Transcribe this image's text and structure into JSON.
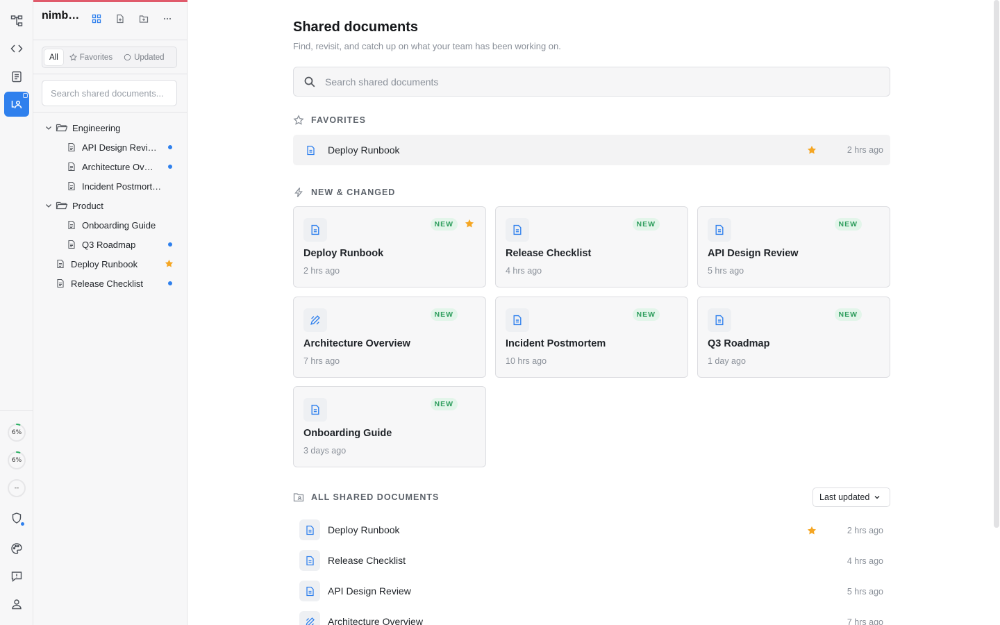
{
  "colors": {
    "accent": "#2f80ed",
    "star": "#f5a623",
    "new_badge_text": "#2e9d5d",
    "new_badge_bg": "#e3f5ea",
    "top_accent": "#e05a6b"
  },
  "rail": {
    "items": [
      {
        "icon": "diagram-icon"
      },
      {
        "icon": "code-icon"
      },
      {
        "icon": "clipboard-icon"
      },
      {
        "icon": "shared-docs-icon",
        "active": true
      }
    ],
    "meters": [
      {
        "label": "6%",
        "value": 0.06
      },
      {
        "label": "6%",
        "value": 0.06
      },
      {
        "label": "--",
        "value": 0
      }
    ],
    "bottom": [
      {
        "icon": "shield-icon"
      },
      {
        "icon": "palette-icon"
      },
      {
        "icon": "feedback-icon"
      },
      {
        "icon": "user-icon"
      }
    ]
  },
  "sidebar": {
    "workspace_title": "nimbus",
    "tools": [
      "grid-icon",
      "new-file-icon",
      "new-folder-icon",
      "more-icon"
    ],
    "filters": [
      {
        "label": "All",
        "active": true
      },
      {
        "label": "Favorites",
        "icon": "star-outline-icon"
      },
      {
        "label": "Updated",
        "icon": "circle-icon"
      }
    ],
    "search_placeholder": "Search shared documents...",
    "tree": [
      {
        "type": "folder",
        "label": "Engineering",
        "depth": 0
      },
      {
        "type": "file",
        "label": "API Design Review",
        "depth": 1,
        "dot": true
      },
      {
        "type": "file",
        "label": "Architecture Overview",
        "depth": 1,
        "dot": true
      },
      {
        "type": "file",
        "label": "Incident Postmortem",
        "depth": 1
      },
      {
        "type": "folder",
        "label": "Product",
        "depth": 0
      },
      {
        "type": "file",
        "label": "Onboarding Guide",
        "depth": 1
      },
      {
        "type": "file",
        "label": "Q3 Roadmap",
        "depth": 1,
        "dot": true
      },
      {
        "type": "file",
        "label": "Deploy Runbook",
        "depth": 0.5,
        "star": true
      },
      {
        "type": "file",
        "label": "Release Checklist",
        "depth": 0.5,
        "dot": true
      }
    ]
  },
  "main": {
    "title": "Shared documents",
    "subtitle": "Find, revisit, and catch up on what your team has been working on.",
    "search_placeholder": "Search shared documents",
    "favorites": {
      "heading": "FAVORITES",
      "items": [
        {
          "name": "Deploy Runbook",
          "time": "2 hrs ago",
          "starred": true
        }
      ]
    },
    "new_changed": {
      "heading": "NEW & CHANGED",
      "badge": "NEW",
      "cards": [
        {
          "title": "Deploy Runbook",
          "time": "2 hrs ago",
          "starred": true,
          "icon": "doc-icon"
        },
        {
          "title": "Release Checklist",
          "time": "4 hrs ago",
          "icon": "doc-icon"
        },
        {
          "title": "API Design Review",
          "time": "5 hrs ago",
          "icon": "doc-icon"
        },
        {
          "title": "Architecture Overview",
          "time": "7 hrs ago",
          "icon": "drawing-icon"
        },
        {
          "title": "Incident Postmortem",
          "time": "10 hrs ago",
          "icon": "doc-icon"
        },
        {
          "title": "Q3 Roadmap",
          "time": "1 day ago",
          "icon": "doc-icon"
        },
        {
          "title": "Onboarding Guide",
          "time": "3 days ago",
          "icon": "doc-icon"
        }
      ]
    },
    "all_docs": {
      "heading": "ALL SHARED DOCUMENTS",
      "sort_label": "Last updated",
      "rows": [
        {
          "name": "Deploy Runbook",
          "time": "2 hrs ago",
          "starred": true,
          "icon": "doc-icon"
        },
        {
          "name": "Release Checklist",
          "time": "4 hrs ago",
          "icon": "doc-icon"
        },
        {
          "name": "API Design Review",
          "time": "5 hrs ago",
          "icon": "doc-icon"
        },
        {
          "name": "Architecture Overview",
          "time": "7 hrs ago",
          "icon": "drawing-icon"
        }
      ]
    }
  }
}
